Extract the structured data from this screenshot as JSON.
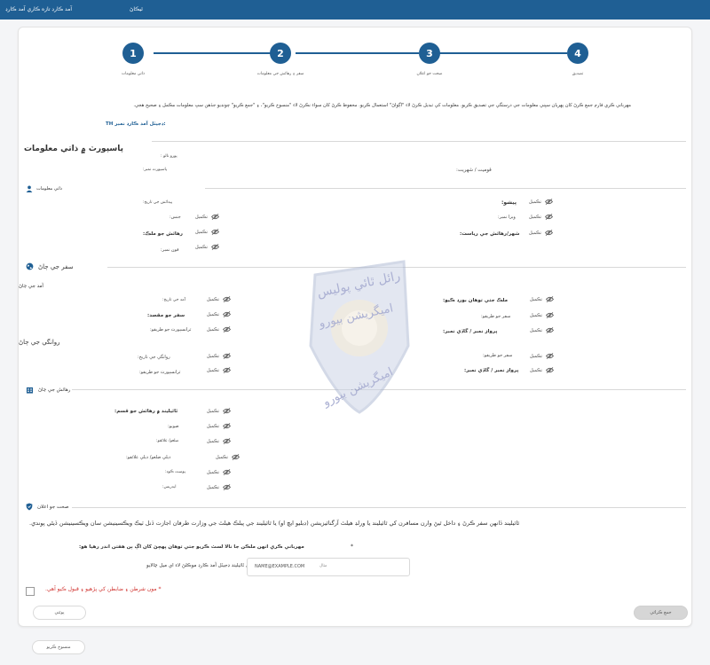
{
  "topbar": {
    "brand": "ٿيڪاڻ",
    "subtitle": "آمد ڪارڊ تازه ڪاري آمد ڪارڊ"
  },
  "steps": [
    {
      "num": "1",
      "label": "ذاتي معلومات"
    },
    {
      "num": "2",
      "label": "سفر ۽ رهائش جي معلومات"
    },
    {
      "num": "3",
      "label": "صحت جو اعلان"
    },
    {
      "num": "4",
      "label": "تصديق"
    }
  ],
  "intro": "مهرباني ڪري فارم جمع ڪرڻ کان پهريان سڀني معلومات جي درستگي جي تصديق ڪريو. معلومات کي تبديل ڪرڻ لاء \"اڳواڻ\" استعمال ڪريو. محفوظ ڪرڻ کان سواء نڪرڻ لاء \"منسوخ ڪريو\"، ۽ \"جمع ڪريو\" چونڊيو جڏهن سڀ معلومات مڪمل ۽ صحيح هجي.",
  "card_no": "TH ڊجيٽل آمد ڪارڊ نمبر:",
  "passport": {
    "title": "پاسپورٽ ۾ ذاتي معلومات",
    "full_name": "پورو نالو :",
    "nationality": "قوميت / شهريت:",
    "passport_no": "پاسپورٽ نمبر:"
  },
  "personal": {
    "title": "ذاتي معلومات",
    "dob": "پيدائش جي تاريخ:",
    "gender": "جنس:",
    "occupation": "پيشو:",
    "visa_no": "ويزا نمبر:",
    "residence_country": "رهائش جو ملڪ:",
    "residence_city": "شهر/رهائش جي رياست:",
    "phone": "فون نمبر:"
  },
  "edit_label": "تڪميل",
  "travel": {
    "title": "سفر جي ڄاڻ",
    "arrival_title": "آمد جي ڄاڻ",
    "boarding_country": "ملڪ جتي توهان بورڊ ڪيو:",
    "arrival_date": "آمد جي تاريخ:",
    "travel_mode": "سفر جو طريقو:",
    "purpose": "سفر جو مقصد:",
    "flight_no": "پرواز نمبر / گاڏي نمبر:",
    "transport_mode": "ٽرانسپورٽ جو طريقو:",
    "departure_title": "روانگي جي ڄاڻ",
    "departure_date": "روانگي جي تاريخ:",
    "dep_travel_mode": "سفر جو طريقو:",
    "dep_transport": "ٽرانسپورٽ جو طريقو:",
    "dep_flight_no": "پرواز نمبر / گاڏي نمبر:"
  },
  "accommodation": {
    "title": "رهائش جي ڄاڻ",
    "type": "ٿائيليند ۾ رهائش جو قسم:",
    "province": "صوبو:",
    "district": "ضلعو/ علائقو:",
    "subdistrict": "ذيلي ضلعو/ ذيلي علائقو:",
    "postcode": "پوسٽ ڪوڊ:",
    "address": "ايڊريس:"
  },
  "health": {
    "title": "صحت جو اعلان",
    "notice": "ٿائيليند ڏانهن سفر ڪرڻ ۽ داخل ٿيڻ وارن مسافرن کي ٿائيليند يا ورلڊ هيلٿ آرگنائيزيشن (ڊبليو ايڇ او) يا ٿائيليند جي پبلڪ هيلٿ جي وزارت طرفان اجازت ڏنل ٽيڪ ويڪسينيشن سان ويڪسينيشن ڏيڻي پوندي.",
    "countries_q": "مهرباني ڪري انهن ملڪن جا نالا لسٽ ڪريو جتي توهان پهچڻ کان اڳ ٻن هفتن اندر رهيا هو:",
    "email_q": "مهرباني ڪري ٿائيليند ڊجيٽل آمد ڪارڊ موڪلڻ لاء اي ميل چالايو",
    "email_placeholder": "NAME@EXAMPLE.COM",
    "email_hint": "مثال",
    "required_mark": "*",
    "consent": "* مون شرطن ۽ ضابطن کي پڙهيو ۽ قبول ڪيو آهي."
  },
  "buttons": {
    "back": "پوئتي",
    "submit": "جمع ڪرائي",
    "cancel": "منسوخ ڪريو"
  },
  "watermark": {
    "line1": "رائل ٿائي پوليس",
    "line2": "اميگريشن بيورو",
    "line3": "اميگريشن بيورو"
  },
  "colors": {
    "brand_blue": "#1f5f94",
    "required_red": "#d0312d"
  }
}
